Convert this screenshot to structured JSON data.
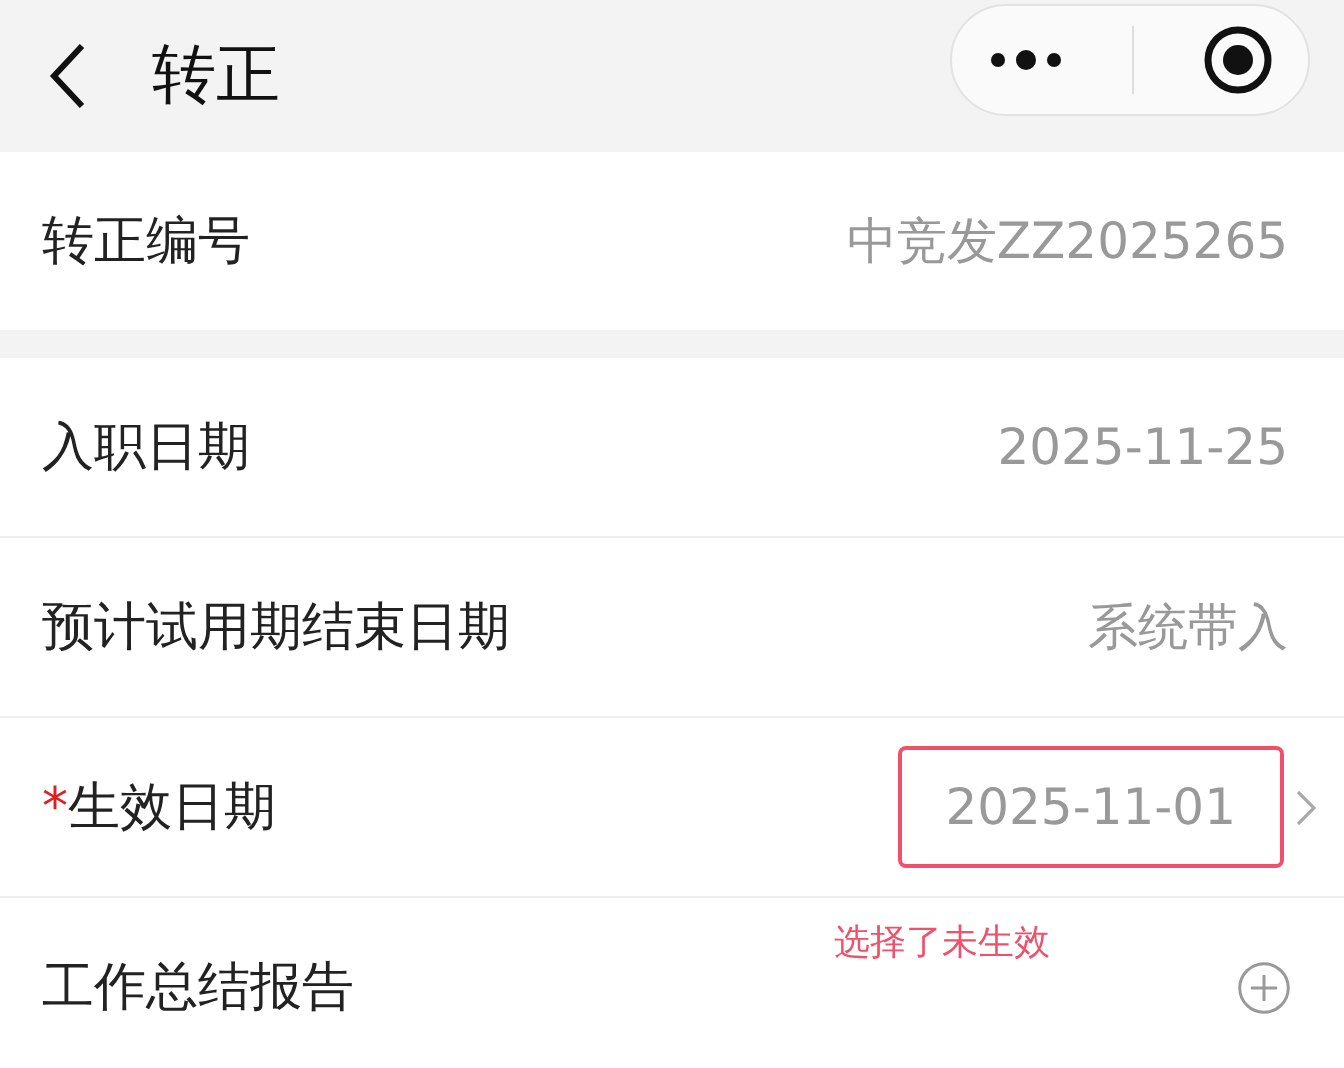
{
  "nav": {
    "title": "转正"
  },
  "sections": [
    {
      "rows": [
        {
          "kind": "text",
          "label": "转正编号",
          "value": "中竞发ZZ2025265"
        }
      ]
    },
    {
      "rows": [
        {
          "kind": "text",
          "label": "入职日期",
          "value": "2025-11-25"
        },
        {
          "kind": "text",
          "label": "预计试用期结束日期",
          "value": "系统带入"
        },
        {
          "kind": "picker",
          "label": "生效日期",
          "required_mark": "*",
          "value": "2025-11-01",
          "highlighted": true
        },
        {
          "kind": "upload",
          "label": "工作总结报告",
          "annotation": "选择了未生效"
        }
      ]
    }
  ]
}
